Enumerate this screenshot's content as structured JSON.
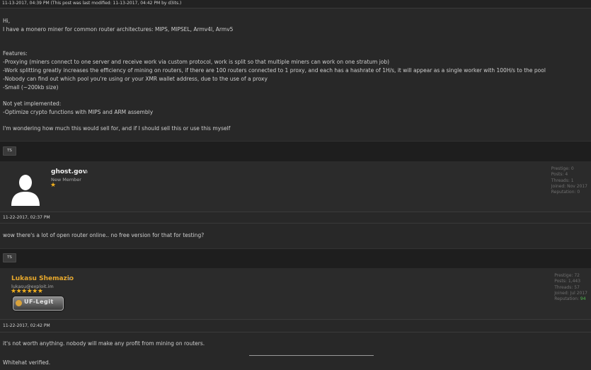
{
  "edit_notice": "11-13-2017, 04:39 PM (This post was last modified: 11-13-2017, 04:42 PM by d3its.)",
  "post1": {
    "lines": [
      "Hi,",
      "I have a monero miner for common router architectures: MIPS, MIPSEL, Armv4l, Armv5",
      "",
      "Features:",
      "-Proxying (miners connect to one server and receive work via custom protocol, work is split so that multiple miners can work on one stratum job)",
      "-Work splitting greatly increases the efficiency of mining on routers, if there are 100 routers connected to 1 proxy, and each has a hashrate of 1H/s, it will appear as a single worker with 100H/s to the pool",
      "-Nobody can find out which pool you're using or your XMR wallet address, due to the use of a proxy",
      "-Small (~200kb size)",
      "",
      "Not yet implemented:",
      "-Optimize crypto functions with MIPS and ARM assembly",
      "",
      "I'm wondering how much this would sell for, and if I should sell this or use this myself"
    ]
  },
  "ts_label": "TS",
  "user1": {
    "name": "ghost.gov",
    "role": "New Member",
    "stars": "★",
    "stats": [
      "Prestige: 0",
      "Posts: 4",
      "Threads: 1",
      "Joined: Nov 2017",
      "Reputation: 0"
    ],
    "post_date": "11-22-2017, 02:37 PM",
    "post_text": "wow there's a lot of open router online.. no free version for that for testing?"
  },
  "user2": {
    "name": "Lukasu Shemazio",
    "email": "lukasu@exploit.im",
    "stars": "★★★★★★",
    "award": "UF-Legit",
    "stats_prefix": [
      "Prestige: 72",
      "Posts: 1,443",
      "Threads: 57",
      "Joined: Jul 2017"
    ],
    "rep_label": "Reputation: ",
    "rep_value": "94",
    "post_date": "11-22-2017, 02:42 PM",
    "post_text": "it's not worth anything. nobody will make any profit from mining on routers.",
    "signature": "Whitehat verified."
  },
  "colors": {
    "background": "#262626",
    "username_gold": "#e8a92c",
    "reputation_green": "#4fb84f",
    "star_gold": "#f2b01e"
  }
}
